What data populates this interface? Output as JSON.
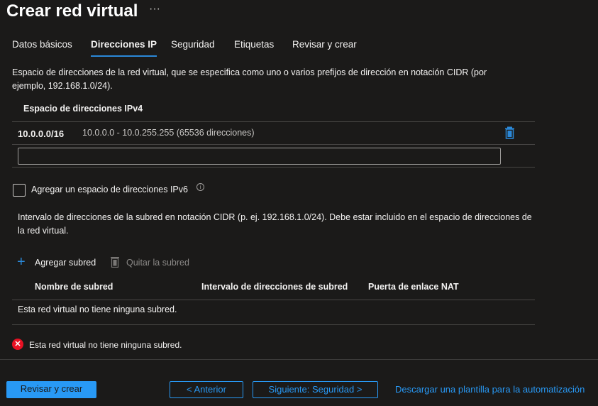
{
  "header": {
    "title": "Crear red virtual",
    "more": "···"
  },
  "tabs": [
    {
      "label": "Datos básicos",
      "active": false
    },
    {
      "label": "Direcciones IP",
      "active": true
    },
    {
      "label": "Seguridad",
      "active": false
    },
    {
      "label": "Etiquetas",
      "active": false
    },
    {
      "label": "Revisar y crear",
      "active": false
    }
  ],
  "description": "Espacio de direcciones de la red virtual, que se especifica como uno o varios prefijos de dirección en notación CIDR (por ejemplo, 192.168.1.0/24).",
  "ipv4": {
    "header": "Espacio de direcciones IPv4",
    "rows": [
      {
        "cidr": "10.0.0.0/16",
        "range": "10.0.0.0 - 10.0.255.255 (65536 direcciones)"
      }
    ],
    "new_value": ""
  },
  "ipv6_checkbox": {
    "label": "Agregar un espacio de direcciones IPv6",
    "checked": false
  },
  "subnet_description": "Intervalo de direcciones de la subred en notación CIDR (p. ej. 192.168.1.0/24). Debe estar incluido en el espacio de direcciones de la red virtual.",
  "subnet_toolbar": {
    "add": "Agregar subred",
    "remove": "Quitar la subred"
  },
  "subnet_table": {
    "columns": [
      "Nombre de subred",
      "Intervalo de direcciones de subred",
      "Puerta de enlace NAT"
    ],
    "empty": "Esta red virtual no tiene ninguna subred."
  },
  "error": "Esta red virtual no tiene ninguna subred.",
  "footer": {
    "review": "Revisar y crear",
    "previous": "< Anterior",
    "next": "Siguiente: Seguridad >",
    "download": "Descargar una plantilla para la automatización"
  },
  "colors": {
    "accent": "#2899f5",
    "error": "#e81123",
    "background": "#1b1a19"
  }
}
